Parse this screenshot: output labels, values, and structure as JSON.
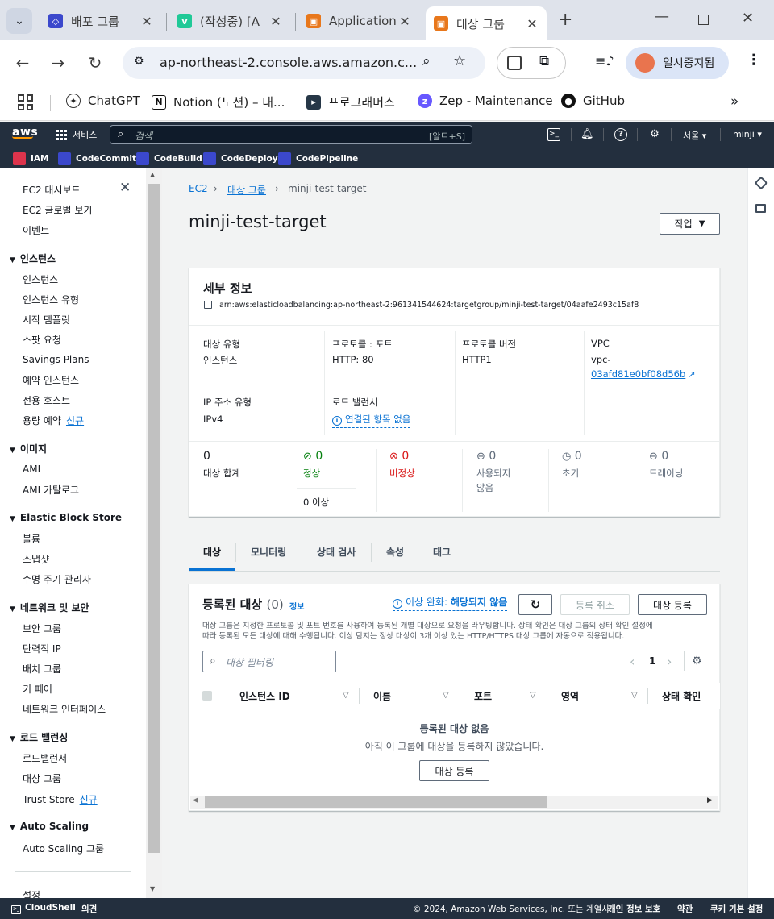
{
  "browser": {
    "tabs": [
      {
        "title": "배포 그룹",
        "color": "#3b48cc"
      },
      {
        "title": "(작성중) [A",
        "color": "#20c997"
      },
      {
        "title": "Application",
        "color": "#e8771b"
      },
      {
        "title": "대상 그룹",
        "color": "#e8771b"
      }
    ],
    "url": "ap-northeast-2.console.aws.amazon.c...",
    "profile_label": "일시중지됨",
    "bookmarks": [
      "ChatGPT",
      "Notion (노션) – 내...",
      "프로그래머스",
      "Zep - Maintenance",
      "GitHub"
    ]
  },
  "aws_header": {
    "logo": "aws",
    "services_label": "서비스",
    "search_placeholder": "검색",
    "search_hint": "[알트+S]",
    "region": "서울 ▾",
    "user": "minji ▾",
    "favorites": [
      "IAM",
      "CodeCommit",
      "CodeBuild",
      "CodeDeploy",
      "CodePipeline"
    ]
  },
  "sidenav": {
    "top_items": [
      "EC2 대시보드",
      "EC2 글로벌 보기",
      "이벤트"
    ],
    "instances_header": "인스턴스",
    "instances": [
      "인스턴스",
      "인스턴스 유형",
      "시작 템플릿",
      "스팟 요청",
      "Savings Plans",
      "예약 인스턴스",
      "전용 호스트",
      "용량 예약"
    ],
    "images_header": "이미지",
    "images": [
      "AMI",
      "AMI 카탈로그"
    ],
    "ebs_header": "Elastic Block Store",
    "ebs": [
      "볼륨",
      "스냅샷",
      "수명 주기 관리자"
    ],
    "network_header": "네트워크 및 보안",
    "network": [
      "보안 그룹",
      "탄력적 IP",
      "배치 그룹",
      "키 페어",
      "네트워크 인터페이스"
    ],
    "lb_header": "로드 밸런싱",
    "lb": [
      "로드밸런서",
      "대상 그룹",
      "Trust Store"
    ],
    "as_header": "Auto Scaling",
    "as": [
      "Auto Scaling 그룹"
    ],
    "settings": "설정",
    "new_badge": "신규"
  },
  "breadcrumb": {
    "ec2": "EC2",
    "tg": "대상 그룹",
    "current": "minji-test-target"
  },
  "page": {
    "title": "minji-test-target",
    "actions": "작업"
  },
  "details": {
    "header": "세부 정보",
    "arn": "arn:aws:elasticloadbalancing:ap-northeast-2:961341544624:targetgroup/minji-test-target/04aafe2493c15af8",
    "target_type_label": "대상 유형",
    "target_type": "인스턴스",
    "protocol_port_label": "프로토콜 : 포트",
    "protocol_port": "HTTP: 80",
    "protocol_version_label": "프로토콜 버전",
    "protocol_version": "HTTP1",
    "vpc_label": "VPC",
    "vpc_line1": "vpc-",
    "vpc_line2": "03afd81e0bf08d56b",
    "ip_type_label": "IP 주소 유형",
    "ip_type": "IPv4",
    "lb_label": "로드 밸런서",
    "lb_value": "연결된 항목 없음",
    "counts": {
      "total": "0",
      "total_label": "대상 합계",
      "healthy": "0",
      "healthy_label": "정상",
      "healthy_sub": "0 이상",
      "unhealthy": "0",
      "unhealthy_label": "비정상",
      "unused": "0",
      "unused_label1": "사용되지",
      "unused_label2": "않음",
      "initial": "0",
      "initial_label": "초기",
      "draining": "0",
      "draining_label": "드레이닝"
    }
  },
  "tabs": [
    "대상",
    "모니터링",
    "상태 검사",
    "속성",
    "태그"
  ],
  "registered": {
    "title": "등록된 대상",
    "count": "(0)",
    "info": "정보",
    "anomaly_prefix": "이상 완화:",
    "anomaly_value": "해당되지 않음",
    "deregister": "등록 취소",
    "register": "대상 등록",
    "desc1": "대상 그룹은 지정한 프로토콜 및 포트 번호를 사용하여 등록된 개별 대상으로 요청을 라우팅합니다. 상태 확인은 대상 그룹의 상태 확인 설정에",
    "desc2": "따라 등록된 모든 대상에 대해 수행됩니다. 이상 탐지는 정상 대상이 3개 이상 있는 HTTP/HTTPS 대상 그룹에 자동으로 적용됩니다.",
    "filter_placeholder": "대상 필터링",
    "page": "1",
    "columns": [
      "인스턴스 ID",
      "이름",
      "포트",
      "영역",
      "상태 확인"
    ],
    "empty_title": "등록된 대상 없음",
    "empty_desc": "아직 이 그룹에 대상을 등록하지 않았습니다.",
    "empty_btn": "대상 등록"
  },
  "footer": {
    "cloudshell": "CloudShell",
    "feedback": "의견",
    "copyright": "© 2024, Amazon Web Services, Inc. 또는 계열사.",
    "privacy": "개인 정보 보호",
    "terms": "약관",
    "cookies": "쿠키 기본 설정"
  },
  "colors": {
    "aws_dark": "#232f3e",
    "link": "#0972d3",
    "healthy": "#037f0c",
    "unhealthy": "#d91515",
    "orange": "#ff9900"
  }
}
